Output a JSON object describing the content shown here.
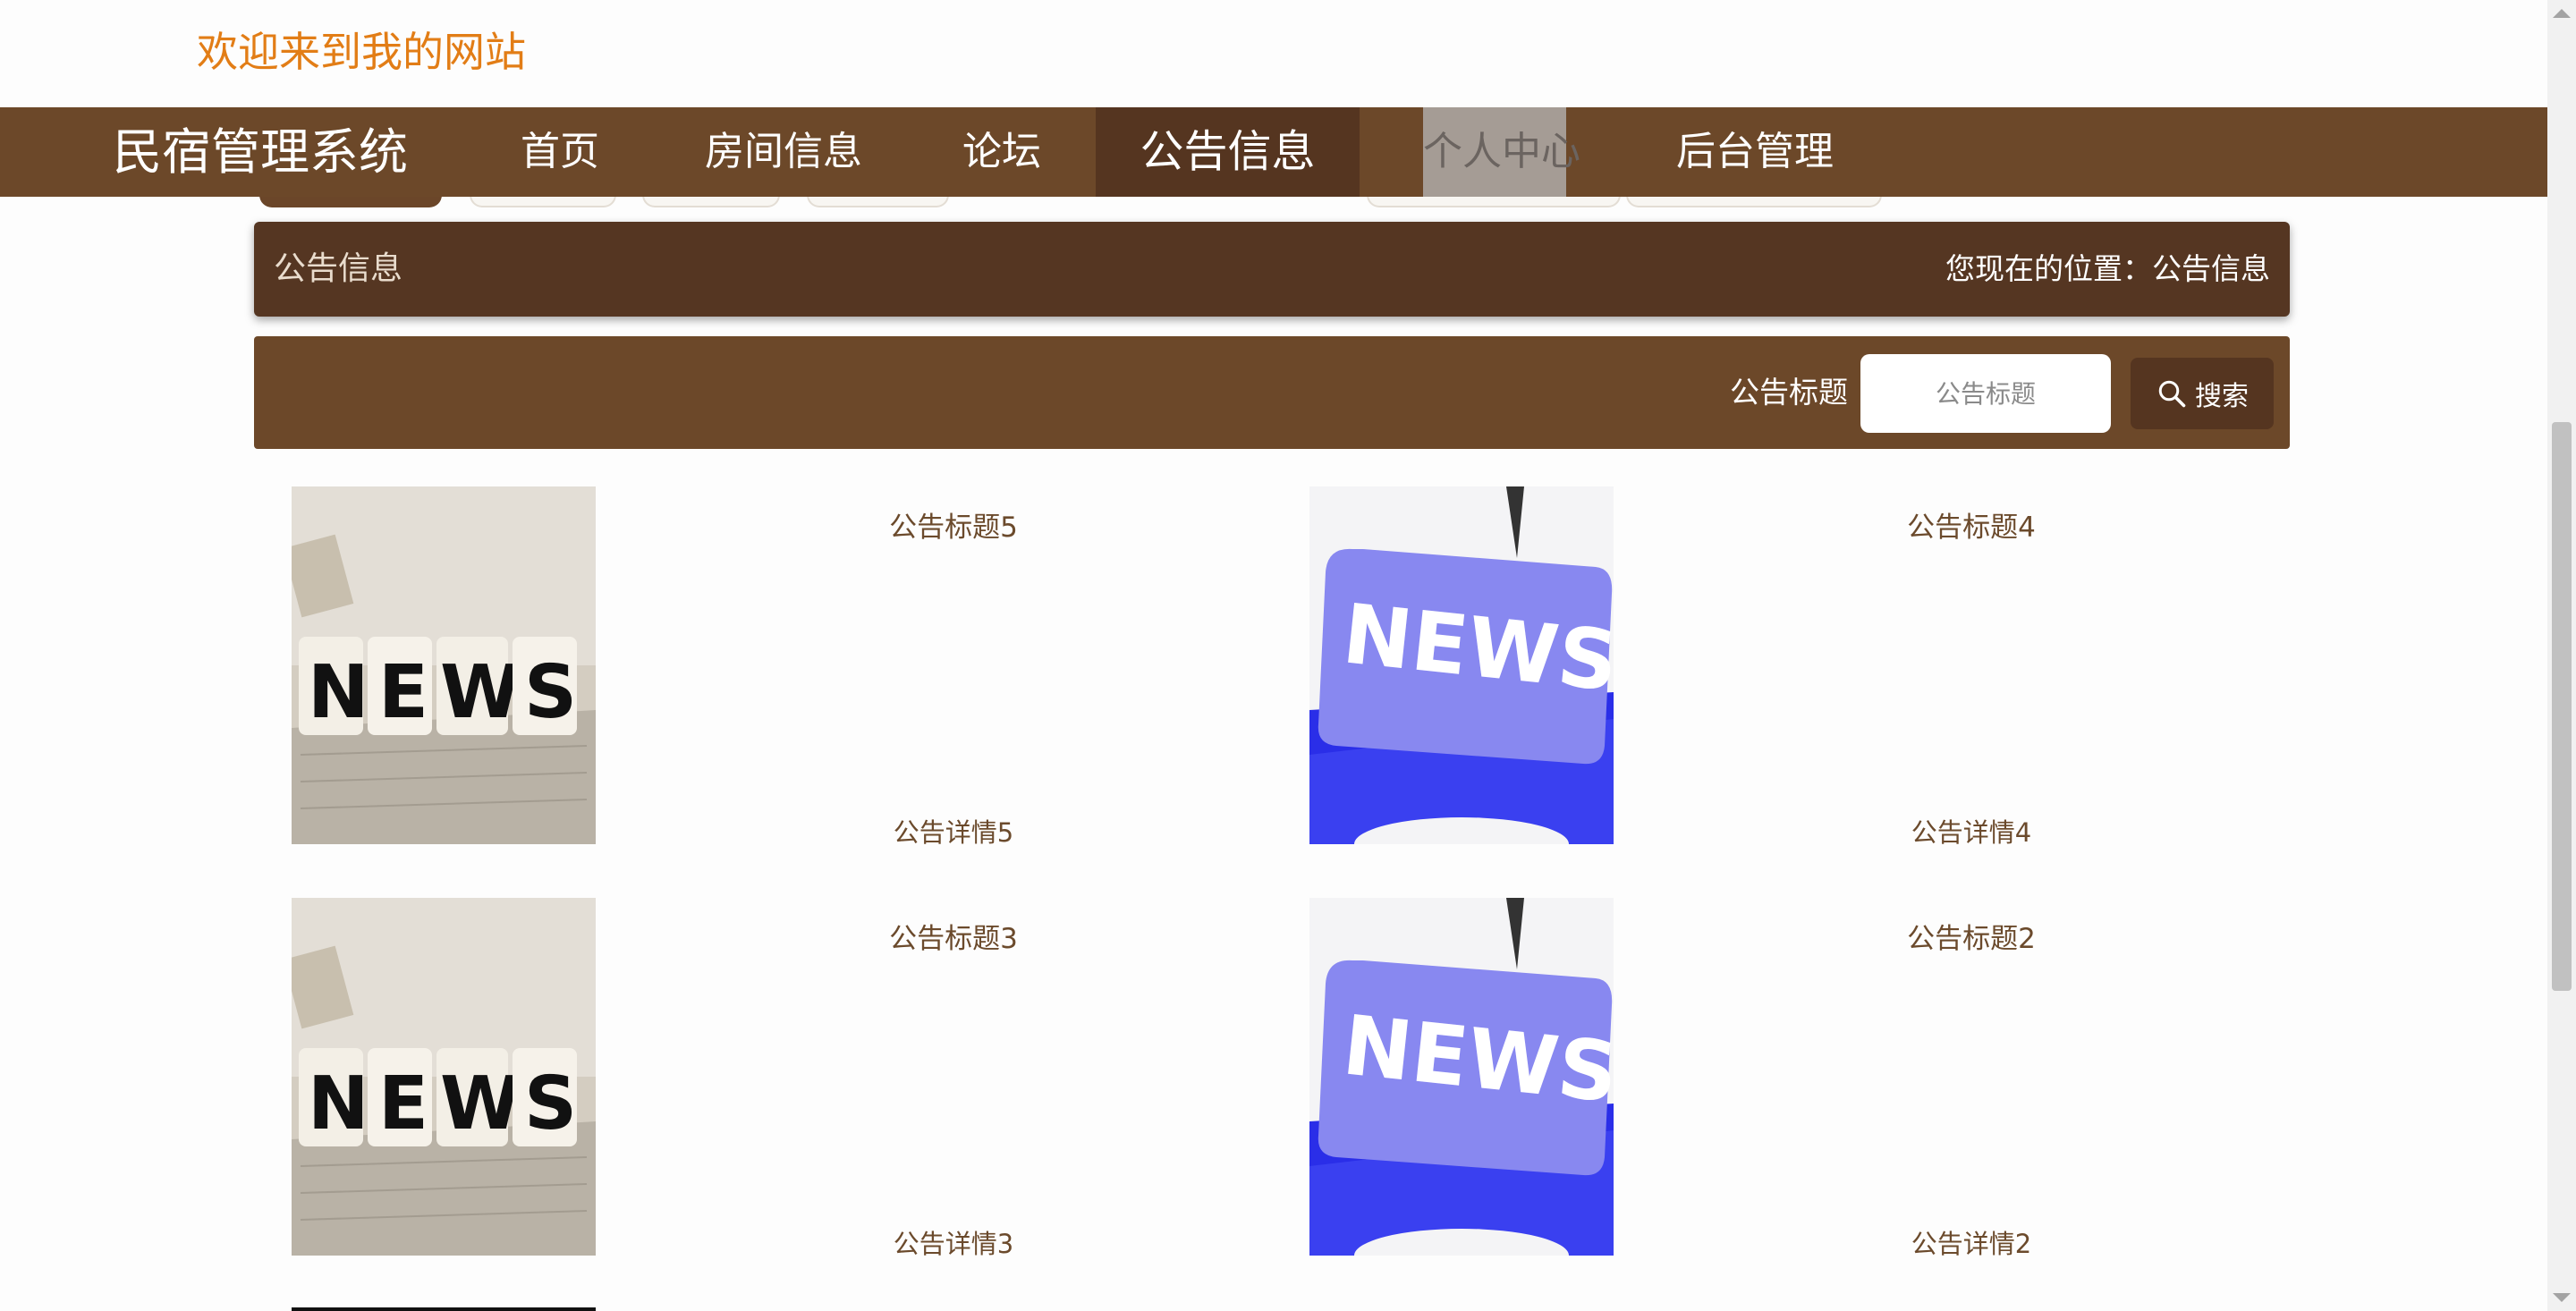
{
  "header": {
    "welcome": "欢迎来到我的网站"
  },
  "nav": {
    "brand": "民宿管理系统",
    "items": [
      {
        "label": "首页"
      },
      {
        "label": "房间信息"
      },
      {
        "label": "论坛"
      },
      {
        "label": "公告信息",
        "state": "active"
      },
      {
        "label": "个人中心",
        "state": "hover"
      },
      {
        "label": "后台管理"
      }
    ]
  },
  "banner": {
    "title": "公告信息",
    "location": "您现在的位置：公告信息"
  },
  "search": {
    "label": "公告标题",
    "placeholder": "公告标题",
    "button_label": "搜索"
  },
  "news": [
    {
      "title": "公告标题5",
      "detail": "公告详情5",
      "image": "news-cubes"
    },
    {
      "title": "公告标题4",
      "detail": "公告详情4",
      "image": "news-key"
    },
    {
      "title": "公告标题3",
      "detail": "公告详情3",
      "image": "news-cubes"
    },
    {
      "title": "公告标题2",
      "detail": "公告详情2",
      "image": "news-key"
    }
  ],
  "colors": {
    "nav_bg": "#6c4829",
    "nav_active": "#553520",
    "banner_bg": "#553622",
    "welcome_text": "#e27d16",
    "news_text": "#6b4a2c"
  }
}
